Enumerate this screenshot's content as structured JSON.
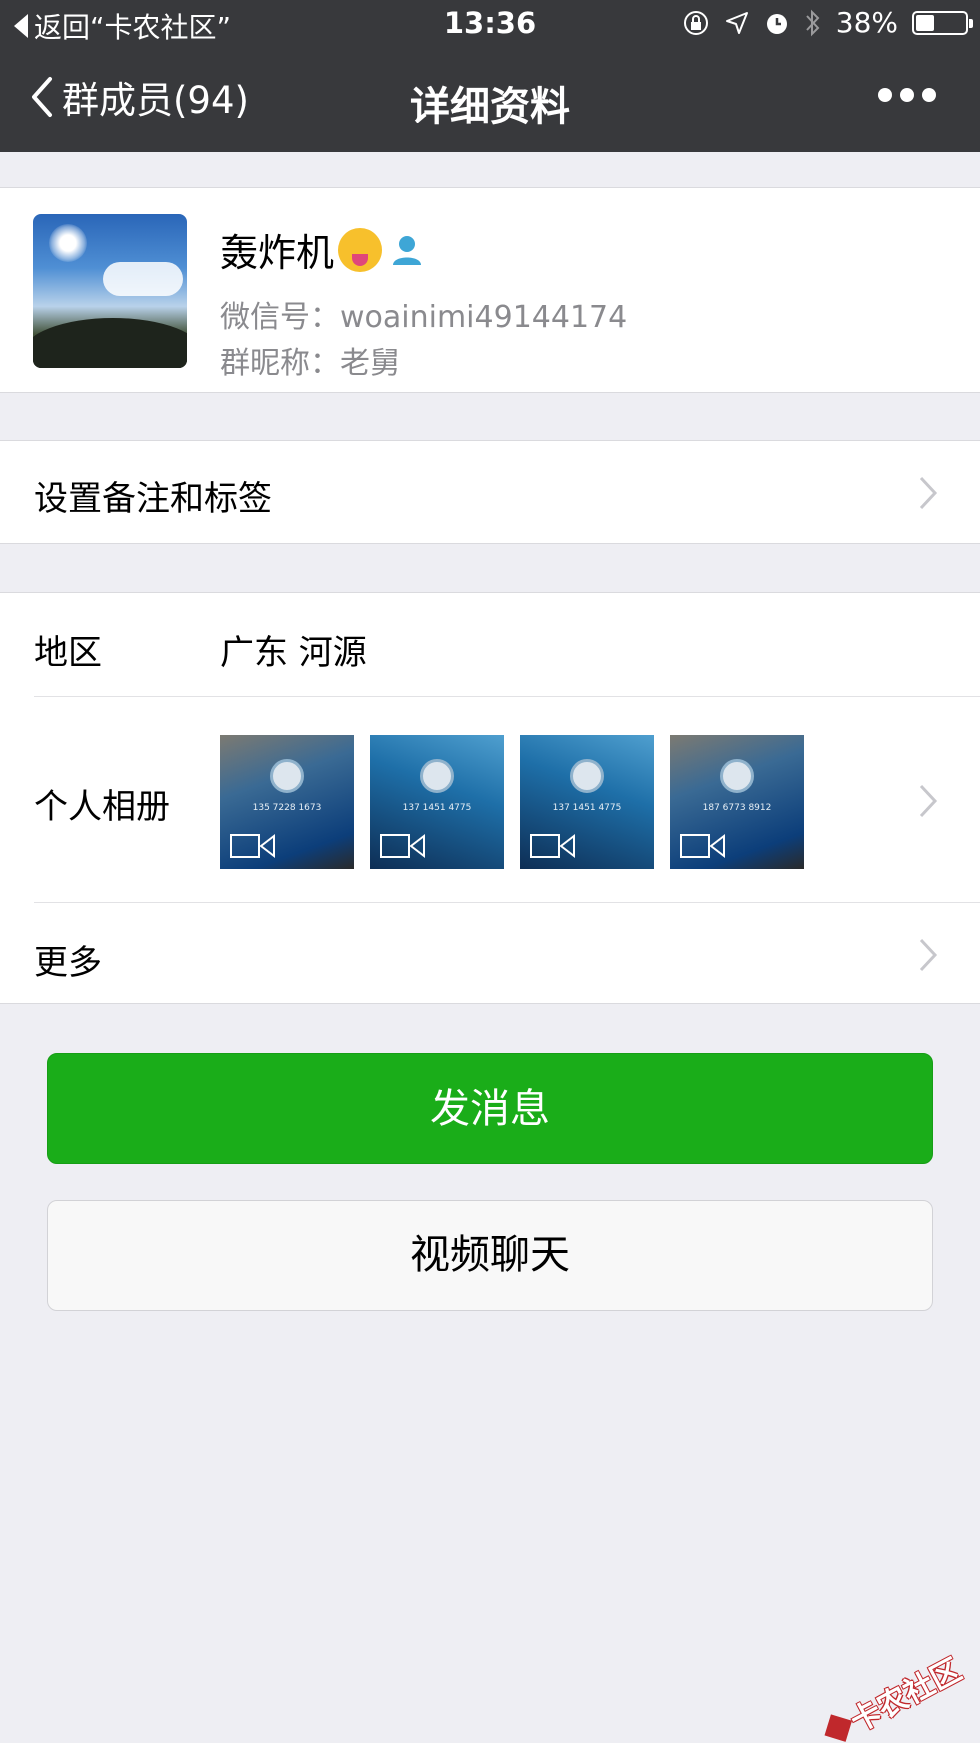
{
  "status_bar": {
    "back_app": "返回“卡农社区”",
    "time": "13:36",
    "battery": "38%",
    "battery_level": 0.38
  },
  "nav": {
    "back_label": "群成员(94)",
    "title": "详细资料"
  },
  "profile": {
    "name": "轰炸机",
    "wechat_id": "微信号：woainimi49144174",
    "group_nickname": "群昵称：老舅"
  },
  "remark": {
    "label": "设置备注和标签"
  },
  "info": {
    "region_label": "地区",
    "region_value": "广东 河源",
    "album_label": "个人相册",
    "album_thumbs": [
      "135 7228 1673",
      "137 1451 4775",
      "137 1451 4775",
      "187 6773 8912"
    ],
    "more_label": "更多"
  },
  "actions": {
    "send_message": "发消息",
    "video_chat": "视频聊天"
  },
  "watermark": "卡农社区",
  "colors": {
    "nav_bg": "#38393c",
    "primary_green": "#1aad19",
    "page_bg": "#eeeef3"
  }
}
